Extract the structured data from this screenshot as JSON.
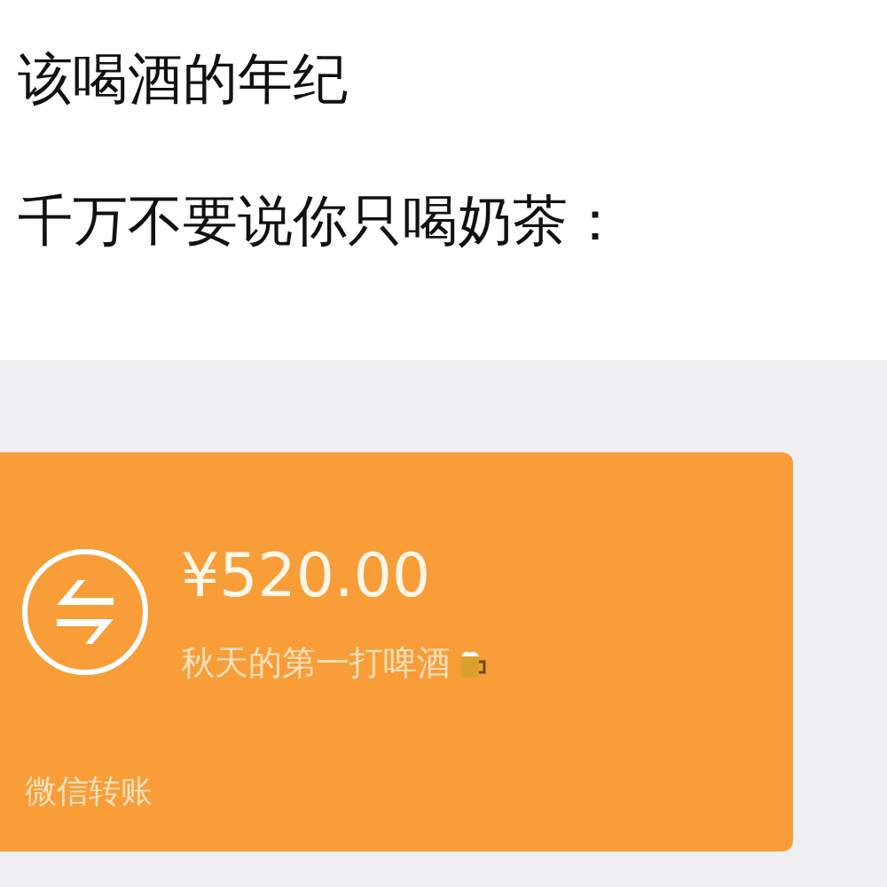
{
  "caption": [
    "该喝酒的年纪",
    "千万不要说你只喝奶茶："
  ],
  "transfer": {
    "amount": "¥520.00",
    "note": "秋天的第一打啤酒",
    "footer": "微信转账"
  }
}
